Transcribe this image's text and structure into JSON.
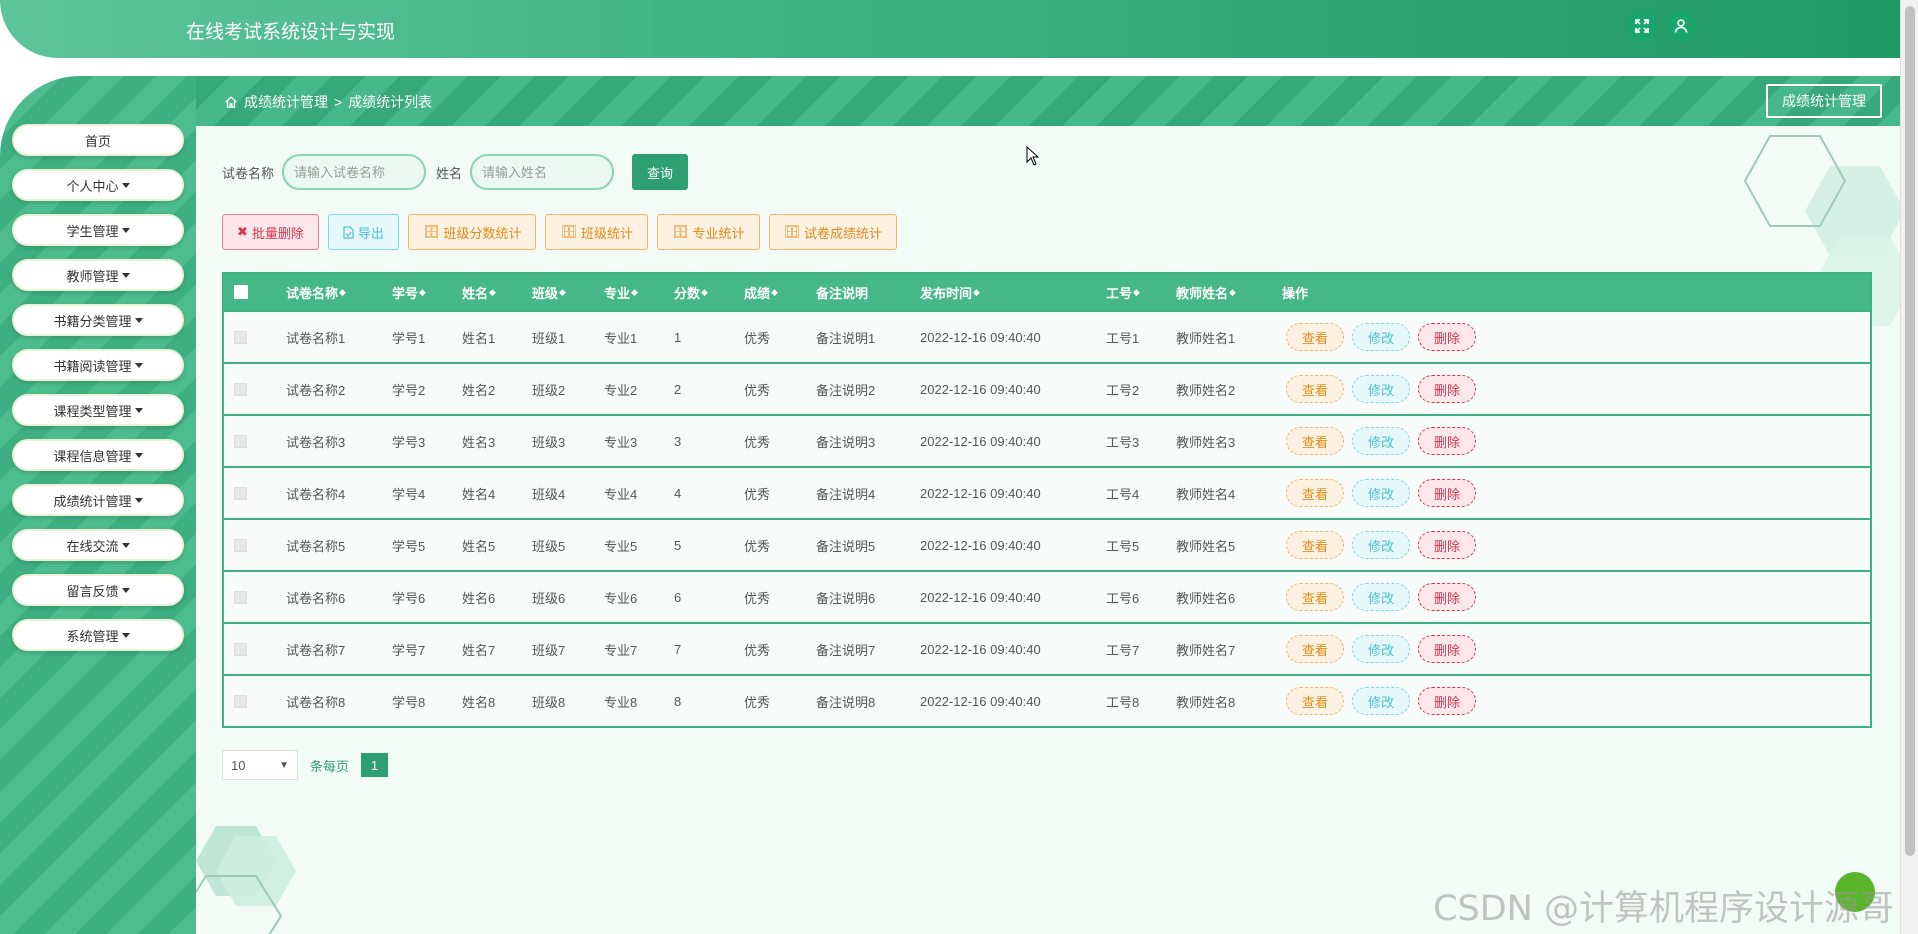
{
  "header": {
    "title": "在线考试系统设计与实现",
    "fullscreen_icon": "expand-icon",
    "user_icon": "user-icon"
  },
  "sidebar": {
    "items": [
      {
        "label": "首页",
        "has_caret": false
      },
      {
        "label": "个人中心",
        "has_caret": true
      },
      {
        "label": "学生管理",
        "has_caret": true
      },
      {
        "label": "教师管理",
        "has_caret": true
      },
      {
        "label": "书籍分类管理",
        "has_caret": true
      },
      {
        "label": "书籍阅读管理",
        "has_caret": true
      },
      {
        "label": "课程类型管理",
        "has_caret": true
      },
      {
        "label": "课程信息管理",
        "has_caret": true
      },
      {
        "label": "成绩统计管理",
        "has_caret": true
      },
      {
        "label": "在线交流",
        "has_caret": true
      },
      {
        "label": "留言反馈",
        "has_caret": true
      },
      {
        "label": "系统管理",
        "has_caret": true
      }
    ]
  },
  "breadcrumb": {
    "root": "成绩统计管理",
    "separator": ">",
    "current": "成绩统计列表",
    "right_button": "成绩统计管理"
  },
  "search": {
    "paper_label": "试卷名称",
    "paper_placeholder": "请输入试卷名称",
    "name_label": "姓名",
    "name_placeholder": "请输入姓名",
    "button": "查询"
  },
  "actions": {
    "batch_delete": "批量删除",
    "export": "导出",
    "class_score_stats": "班级分数统计",
    "class_stats": "班级统计",
    "major_stats": "专业统计",
    "paper_score_stats": "试卷成绩统计"
  },
  "table": {
    "headers": {
      "paper": "试卷名称",
      "student_no": "学号",
      "name": "姓名",
      "class": "班级",
      "major": "专业",
      "score": "分数",
      "grade": "成绩",
      "remark": "备注说明",
      "time": "发布时间",
      "staff_no": "工号",
      "teacher": "教师姓名",
      "ops": "操作"
    },
    "sort_glyph": "◆",
    "op_labels": {
      "view": "查看",
      "edit": "修改",
      "delete": "删除"
    },
    "rows": [
      {
        "paper": "试卷名称1",
        "student_no": "学号1",
        "name": "姓名1",
        "class": "班级1",
        "major": "专业1",
        "score": "1",
        "grade": "优秀",
        "remark": "备注说明1",
        "time": "2022-12-16 09:40:40",
        "staff_no": "工号1",
        "teacher": "教师姓名1"
      },
      {
        "paper": "试卷名称2",
        "student_no": "学号2",
        "name": "姓名2",
        "class": "班级2",
        "major": "专业2",
        "score": "2",
        "grade": "优秀",
        "remark": "备注说明2",
        "time": "2022-12-16 09:40:40",
        "staff_no": "工号2",
        "teacher": "教师姓名2"
      },
      {
        "paper": "试卷名称3",
        "student_no": "学号3",
        "name": "姓名3",
        "class": "班级3",
        "major": "专业3",
        "score": "3",
        "grade": "优秀",
        "remark": "备注说明3",
        "time": "2022-12-16 09:40:40",
        "staff_no": "工号3",
        "teacher": "教师姓名3"
      },
      {
        "paper": "试卷名称4",
        "student_no": "学号4",
        "name": "姓名4",
        "class": "班级4",
        "major": "专业4",
        "score": "4",
        "grade": "优秀",
        "remark": "备注说明4",
        "time": "2022-12-16 09:40:40",
        "staff_no": "工号4",
        "teacher": "教师姓名4"
      },
      {
        "paper": "试卷名称5",
        "student_no": "学号5",
        "name": "姓名5",
        "class": "班级5",
        "major": "专业5",
        "score": "5",
        "grade": "优秀",
        "remark": "备注说明5",
        "time": "2022-12-16 09:40:40",
        "staff_no": "工号5",
        "teacher": "教师姓名5"
      },
      {
        "paper": "试卷名称6",
        "student_no": "学号6",
        "name": "姓名6",
        "class": "班级6",
        "major": "专业6",
        "score": "6",
        "grade": "优秀",
        "remark": "备注说明6",
        "time": "2022-12-16 09:40:40",
        "staff_no": "工号6",
        "teacher": "教师姓名6"
      },
      {
        "paper": "试卷名称7",
        "student_no": "学号7",
        "name": "姓名7",
        "class": "班级7",
        "major": "专业7",
        "score": "7",
        "grade": "优秀",
        "remark": "备注说明7",
        "time": "2022-12-16 09:40:40",
        "staff_no": "工号7",
        "teacher": "教师姓名7"
      },
      {
        "paper": "试卷名称8",
        "student_no": "学号8",
        "name": "姓名8",
        "class": "班级8",
        "major": "专业8",
        "score": "8",
        "grade": "优秀",
        "remark": "备注说明8",
        "time": "2022-12-16 09:40:40",
        "staff_no": "工号8",
        "teacher": "教师姓名8"
      }
    ]
  },
  "pagination": {
    "page_size": "10",
    "per_page_label": "条每页",
    "current_page": "1"
  },
  "watermark": "CSDN @计算机程序设计源哥",
  "colors": {
    "primary": "#2e9f72",
    "header": "#40b386",
    "danger": "#d4374f",
    "warning": "#e28c1c",
    "info": "#4bc0d6"
  }
}
